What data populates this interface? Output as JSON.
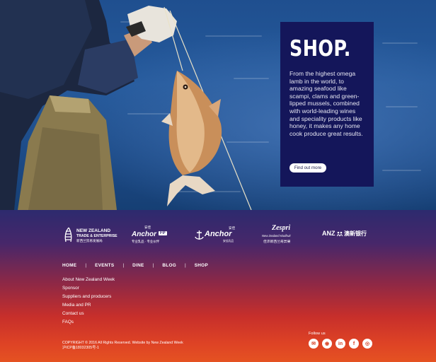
{
  "hero": {
    "title": "SHOP.",
    "description": "From the highest omega lamb in the world, to amazing seafood like scampi, clams and green-lipped mussels, combined with world-leading wines and speciality products like honey, it makes any home cook produce great results.",
    "button_label": "Find out more"
  },
  "logos": {
    "nzte": {
      "line1": "NEW ZEALAND",
      "line2": "TRADE & ENTERPRISE",
      "line3": "新西兰贸易发展局"
    },
    "anchor_fp": {
      "name": "Anchor",
      "badge": "FP",
      "cn_top": "安佳",
      "cn_sub": "专业乳品 · 专业伙伴"
    },
    "anchor": {
      "name": "Anchor",
      "cn_top": "安佳",
      "cn_sub": "安佳乳品"
    },
    "zespri": {
      "name": "Zespri",
      "line2": "New Zealand Kiwifruit",
      "line3": "佳沛新西兰奇异果"
    },
    "anz": {
      "name": "ANZ",
      "cn": "澳新银行"
    }
  },
  "nav": [
    "HOME",
    "EVENTS",
    "DINE",
    "BLOG",
    "SHOP"
  ],
  "nav_separator": "|",
  "footer_links": [
    "About New Zealand Week",
    "Sponsor",
    "Suppliers and producers",
    "Media and PR",
    "Contact us",
    "FAQs"
  ],
  "copyright": {
    "line1": "COPYRIGHT © 2016 All Rights Reserved. Website by New Zealand Week",
    "line2": "沪ICP备18032305号-1"
  },
  "follow_label": "Follow us",
  "social": [
    {
      "icon": "wechat-icon",
      "glyph": "✉"
    },
    {
      "icon": "weibo-icon",
      "glyph": "◉"
    },
    {
      "icon": "linkedin-icon",
      "glyph": "in"
    },
    {
      "icon": "facebook-icon",
      "glyph": "f"
    },
    {
      "icon": "instagram-icon",
      "glyph": "◎"
    }
  ],
  "colors": {
    "panel": "#14165a",
    "footer_top": "#2d2a6e",
    "footer_bottom": "#e55222"
  }
}
